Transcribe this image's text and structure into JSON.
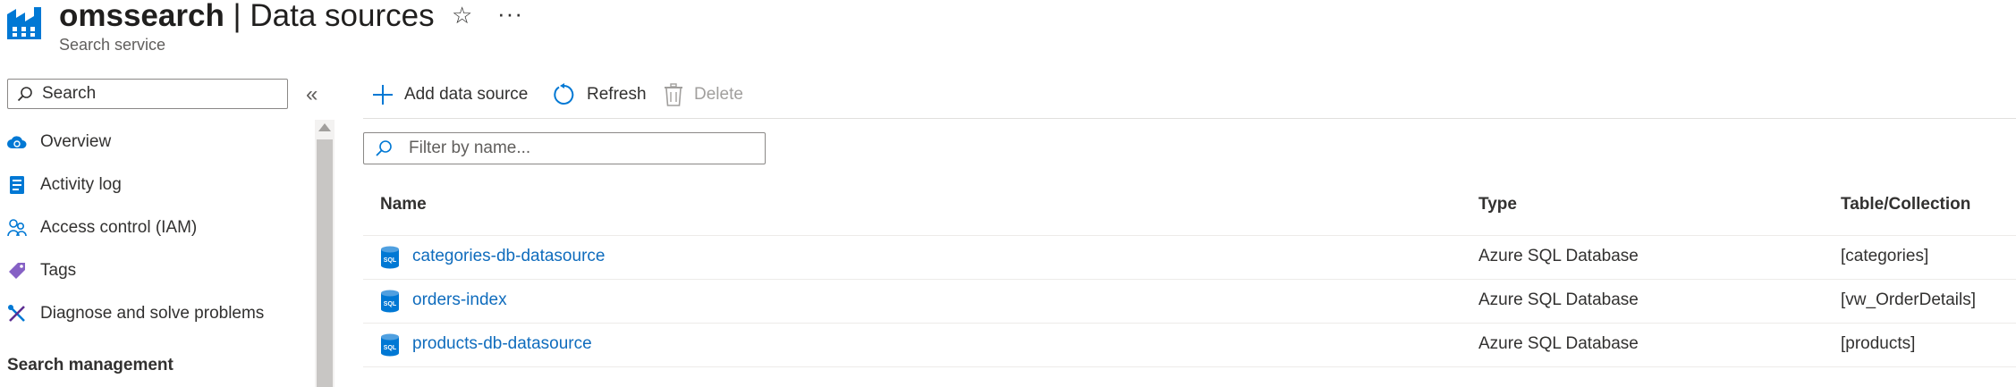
{
  "header": {
    "resource_name": "omssearch",
    "separator": " | ",
    "page_name": "Data sources",
    "subtitle": "Search service",
    "favorite_glyph": "☆",
    "more_glyph": "···"
  },
  "sidebar": {
    "search_placeholder": "Search",
    "collapse_glyph": "«",
    "items": [
      {
        "label": "Overview",
        "icon": "overview-cloud-icon"
      },
      {
        "label": "Activity log",
        "icon": "activity-log-icon"
      },
      {
        "label": "Access control (IAM)",
        "icon": "people-icon"
      },
      {
        "label": "Tags",
        "icon": "tag-icon"
      },
      {
        "label": "Diagnose and solve problems",
        "icon": "wrench-icon"
      }
    ],
    "section_heading": "Search management"
  },
  "toolbar": {
    "add_label": "Add data source",
    "refresh_label": "Refresh",
    "delete_label": "Delete"
  },
  "filter": {
    "placeholder": "Filter by name..."
  },
  "table": {
    "columns": [
      "Name",
      "Type",
      "Table/Collection"
    ],
    "rows": [
      {
        "name": "categories-db-datasource",
        "type": "Azure SQL Database",
        "collection": "[categories]"
      },
      {
        "name": "orders-index",
        "type": "Azure SQL Database",
        "collection": "[vw_OrderDetails]"
      },
      {
        "name": "products-db-datasource",
        "type": "Azure SQL Database",
        "collection": "[products]"
      }
    ],
    "row_icon_text": "SQL"
  },
  "colors": {
    "accent": "#0f6cbd",
    "text": "#323130",
    "disabled": "#a19f9d",
    "icon_blue": "#0078d4"
  }
}
